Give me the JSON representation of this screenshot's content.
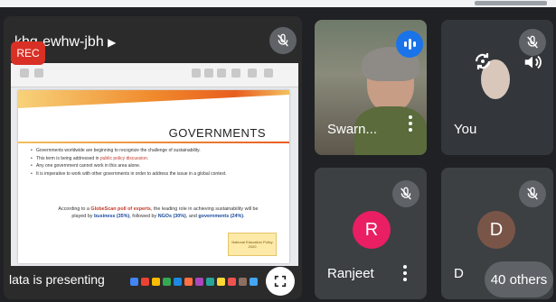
{
  "presentation": {
    "meeting_code": "khg-ewhw-jbh",
    "rec_label": "REC",
    "presenter_label": "lata is presenting",
    "slide": {
      "heading": "GOVERNMENTS",
      "bullets": [
        {
          "pre": "Governments worldwide are beginning to recognize the challenge of sustainability.",
          "hl": "",
          "post": ""
        },
        {
          "pre": "This term is being addressed in ",
          "hl": "public policy discussion.",
          "post": ""
        },
        {
          "pre": "Any one government cannot work in this area alone.",
          "hl": "",
          "post": ""
        },
        {
          "pre": "It is imperative to work with other governments in order to address the issue in a global context.",
          "hl": "",
          "post": ""
        }
      ],
      "quote_pre": "According to a ",
      "quote_src": "GlobeScan poll of experts",
      "quote_mid": ", the leading role in achieving sustainability will be played by ",
      "quote_b1": "business (35%)",
      "quote_mid2": ", followed by ",
      "quote_b2": "NGOs (30%)",
      "quote_mid3": ", and ",
      "quote_b3": "governments (24%)",
      "quote_end": ".",
      "badge": "National Education Policy 2020"
    }
  },
  "participants": [
    {
      "id": "swarn",
      "name": "Swarn...",
      "state": "speaking"
    },
    {
      "id": "you",
      "name": "You",
      "state": "muted"
    },
    {
      "id": "ranjeet",
      "name": "Ranjeet",
      "initial": "R",
      "avatar_color": "#e91e63",
      "state": "muted"
    },
    {
      "id": "d",
      "name": "D",
      "initial": "D",
      "avatar_color": "#795548",
      "state": "muted"
    }
  ],
  "others_label": "40 others",
  "colors": {
    "rec": "#d93025",
    "tile_bg": "#3c4043",
    "muted_badge": "#5f6368",
    "speaking": "#1a73e8"
  }
}
